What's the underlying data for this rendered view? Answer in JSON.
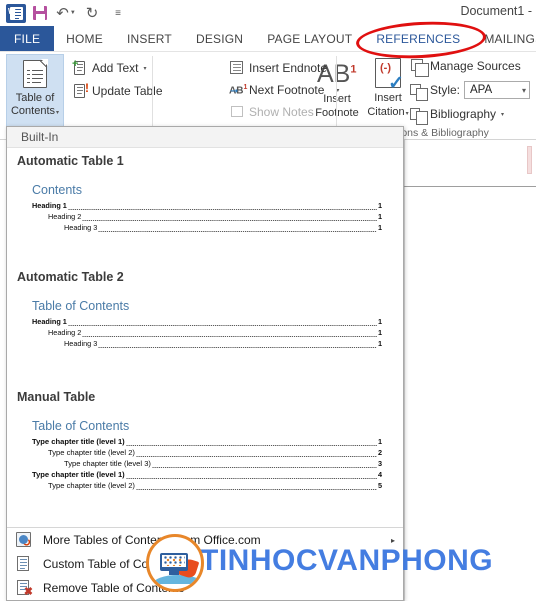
{
  "titlebar": {
    "document_title": "Document1 -",
    "qat": {
      "app_icon": "word-icon",
      "save": "save-icon",
      "undo": "undo-icon",
      "redo": "redo-icon",
      "customize": "customize-quick-access-toolbar-icon"
    }
  },
  "tabs": [
    {
      "label": "FILE",
      "state": "file"
    },
    {
      "label": "HOME",
      "state": "normal"
    },
    {
      "label": "INSERT",
      "state": "normal"
    },
    {
      "label": "DESIGN",
      "state": "normal"
    },
    {
      "label": "PAGE LAYOUT",
      "state": "normal"
    },
    {
      "label": "REFERENCES",
      "state": "active"
    },
    {
      "label": "MAILINGS",
      "state": "normal"
    }
  ],
  "ribbon": {
    "toc_group": {
      "big_button": {
        "line1": "Table of",
        "line2": "Contents",
        "caret": "▾"
      },
      "add_text": "Add Text",
      "add_text_caret": "▾",
      "update_table": "Update Table"
    },
    "footnotes_group": {
      "insert_footnote_glyph": "AB",
      "insert_footnote_sup": "1",
      "insert_footnote_line1": "Insert",
      "insert_footnote_line2": "Footnote",
      "insert_endnote": "Insert Endnote",
      "next_footnote": "Next Footnote",
      "next_footnote_caret": "▾",
      "show_notes": "Show Notes"
    },
    "citations_group": {
      "insert_citation_line1": "Insert",
      "insert_citation_line2": "Citation",
      "insert_citation_caret": "▾",
      "manage_sources": "Manage Sources",
      "style_label": "Style:",
      "style_value": "APA",
      "style_caret": "▾",
      "bibliography": "Bibliography",
      "bibliography_caret": "▾",
      "group_label_visible": "ions & Bibliography"
    }
  },
  "gallery": {
    "header": "Built-In",
    "items": [
      {
        "title": "Automatic Table 1",
        "preview_heading": "Contents",
        "rows": [
          {
            "level": 1,
            "text": "Heading 1",
            "page": "1"
          },
          {
            "level": 2,
            "text": "Heading 2",
            "page": "1"
          },
          {
            "level": 3,
            "text": "Heading 3",
            "page": "1"
          }
        ]
      },
      {
        "title": "Automatic Table 2",
        "preview_heading": "Table of Contents",
        "rows": [
          {
            "level": 1,
            "text": "Heading 1",
            "page": "1"
          },
          {
            "level": 2,
            "text": "Heading 2",
            "page": "1"
          },
          {
            "level": 3,
            "text": "Heading 3",
            "page": "1"
          }
        ]
      },
      {
        "title": "Manual Table",
        "preview_heading": "Table of Contents",
        "rows": [
          {
            "level": 1,
            "text": "Type chapter title (level 1)",
            "page": "1"
          },
          {
            "level": 2,
            "text": "Type chapter title (level 2)",
            "page": "2"
          },
          {
            "level": 3,
            "text": "Type chapter title (level 3)",
            "page": "3"
          },
          {
            "level": 1,
            "text": "Type chapter title (level 1)",
            "page": "4"
          },
          {
            "level": 2,
            "text": "Type chapter title (level 2)",
            "page": "5"
          }
        ]
      }
    ],
    "menu": [
      {
        "label": "More Tables of Contents from Office.com",
        "icon": "office-online-icon",
        "submenu": "▸"
      },
      {
        "label": "Custom Table of Contents...",
        "icon": "custom-toc-icon",
        "submenu": ""
      },
      {
        "label": "Remove Table of Contents",
        "icon": "remove-toc-icon",
        "submenu": ""
      }
    ]
  },
  "annotations": {
    "highlight_target": "REFERENCES",
    "highlight_color": "#e01010",
    "watermark_text": "TINHOCVANPHONG",
    "watermark_color": "#3a77e0",
    "logo_ring_color": "#e8872a"
  }
}
